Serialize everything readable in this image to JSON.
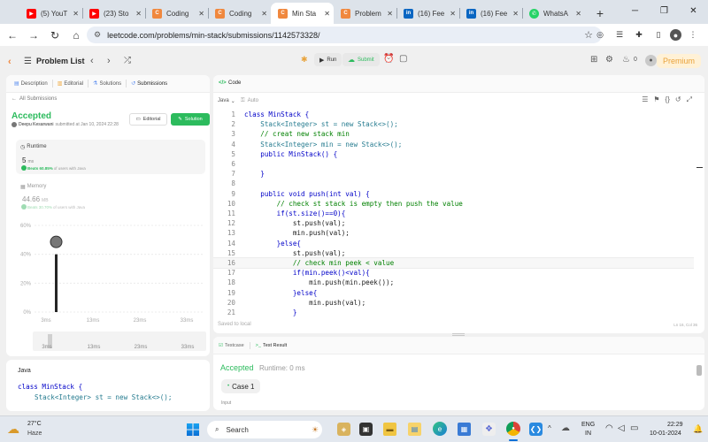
{
  "browser": {
    "tabs": [
      {
        "label": "(5) YouT",
        "icon": "youtube-icon",
        "color": "#ff0000"
      },
      {
        "label": "(23) Sto",
        "icon": "youtube-icon",
        "color": "#ff0000"
      },
      {
        "label": "Coding",
        "icon": "leetcode-icon",
        "color": "#f0883e"
      },
      {
        "label": "Coding",
        "icon": "leetcode-icon",
        "color": "#f0883e"
      },
      {
        "label": "Min Sta",
        "icon": "leetcode-icon",
        "color": "#f0883e",
        "active": true
      },
      {
        "label": "Problem",
        "icon": "leetcode-icon",
        "color": "#f0883e"
      },
      {
        "label": "(16) Fee",
        "icon": "linkedin-icon",
        "color": "#0a66c2"
      },
      {
        "label": "(16) Fee",
        "icon": "linkedin-icon",
        "color": "#0a66c2"
      },
      {
        "label": "WhatsA",
        "icon": "whatsapp-icon",
        "color": "#25d366"
      }
    ],
    "url": "leetcode.com/problems/min-stack/submissions/1142573328/"
  },
  "lcnav": {
    "problem_list": "Problem List",
    "run": "Run",
    "submit": "Submit",
    "streak": "0",
    "premium": "Premium"
  },
  "left": {
    "tabs": [
      "Description",
      "Editorial",
      "Solutions",
      "Submissions"
    ],
    "back": "All Submissions",
    "status": "Accepted",
    "author": "Deepu Kesarwani",
    "submitted": "submitted at Jan 10, 2024 22:28",
    "editorial_btn": "Editorial",
    "solution_btn": "Solution",
    "runtime": {
      "label": "Runtime",
      "value": "5",
      "unit": "ms",
      "beats_pct": "Beats 60.85%",
      "beats_rest": "of users with Java"
    },
    "memory": {
      "label": "Memory",
      "value": "44.66",
      "unit": "MB",
      "beats_pct": "Beats 30.70%",
      "beats_rest": "of users with Java"
    },
    "chart_yticks": [
      "60%",
      "40%",
      "20%",
      "0%"
    ],
    "chart_xticks": [
      "3ms",
      "13ms",
      "23ms",
      "33ms"
    ],
    "mini_xticks": [
      "3ms",
      "13ms",
      "23ms",
      "33ms"
    ],
    "lang": "Java",
    "code_preview": [
      "class MinStack {",
      "Stack<Integer> st = new Stack<>();"
    ]
  },
  "chart_data": {
    "type": "bar",
    "categories": [
      "3ms"
    ],
    "values": [
      40
    ],
    "ylim": [
      0,
      60
    ],
    "yticks": [
      "60%",
      "40%",
      "20%",
      "0%"
    ],
    "xticks": [
      "3ms",
      "13ms",
      "23ms",
      "33ms"
    ]
  },
  "editor": {
    "title": "Code",
    "language": "Java",
    "mode": "Auto",
    "lines": [
      "class MinStack {",
      "    Stack<Integer> st = new Stack<>();",
      "    // creat new stack min",
      "    Stack<Integer> min = new Stack<>();",
      "    public MinStack() {",
      "",
      "    }",
      "",
      "    public void push(int val) {",
      "        // check st stack is empty then push the value",
      "        if(st.size()==0){",
      "            st.push(val);",
      "            min.push(val);",
      "        }else{",
      "            st.push(val);",
      "            // check min peek < value",
      "            if(min.peek()<val){",
      "                min.push(min.peek());",
      "            }else{",
      "                min.push(val);",
      "            }"
    ],
    "saved": "Saved to local",
    "cursor": "Ln 16, Col 36"
  },
  "bottom": {
    "tabs": [
      "Testcase",
      "Test Result"
    ],
    "status": "Accepted",
    "runtime": "Runtime: 0 ms",
    "case": "Case 1",
    "input_label": "Input"
  },
  "taskbar": {
    "temp": "27°C",
    "weather": "Haze",
    "search": "Search",
    "lang1": "ENG",
    "lang2": "IN",
    "time": "22:29",
    "date": "10-01-2024"
  }
}
